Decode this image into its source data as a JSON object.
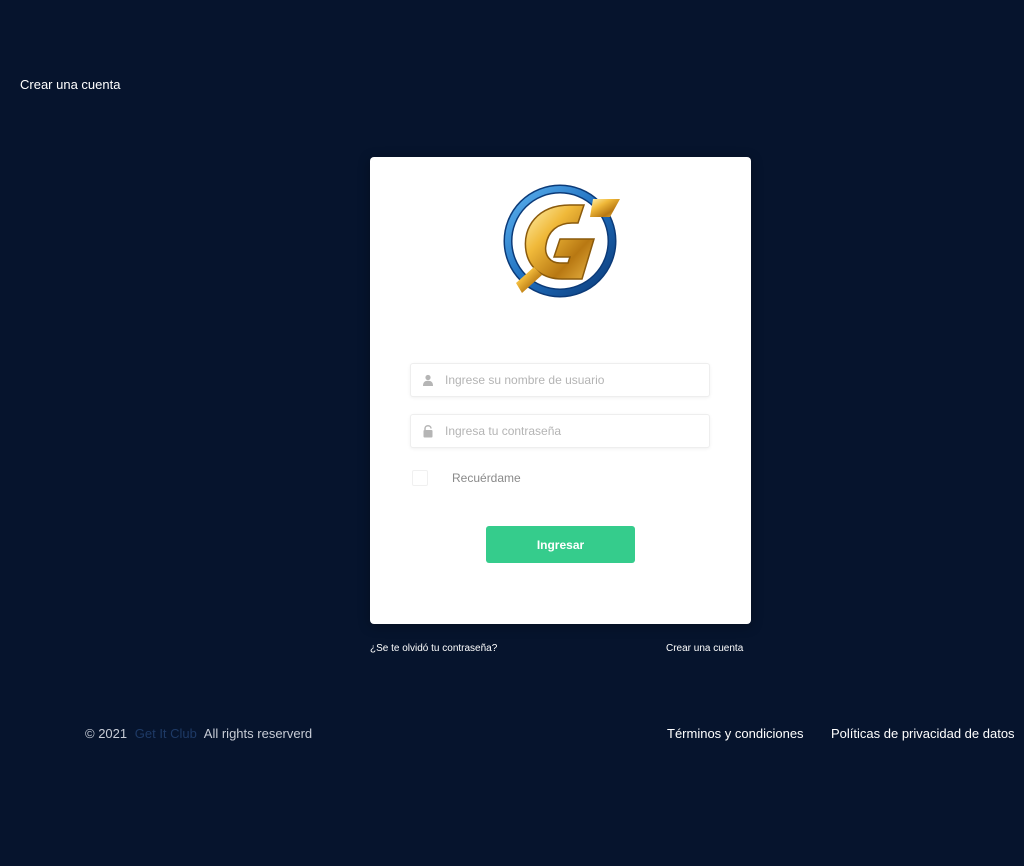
{
  "header": {
    "create_account": "Crear una cuenta"
  },
  "login": {
    "username_placeholder": "Ingrese su nombre de usuario",
    "password_placeholder": "Ingresa tu contraseña",
    "remember_label": "Recuérdame",
    "submit_label": "Ingresar",
    "username_icon": "user-icon",
    "password_icon": "lock-icon"
  },
  "links": {
    "forgot_password": "¿Se te olvidó tu contraseña?",
    "create_account": "Crear una cuenta"
  },
  "footer": {
    "copyright": "© 2021",
    "brand": "Get It Club",
    "rights": "All rights reserverd",
    "terms": "Términos y condiciones",
    "privacy": "Políticas de privacidad de datos"
  },
  "colors": {
    "background": "#06142d",
    "accent_button": "#35cc8c",
    "card": "#ffffff",
    "logo_gold": "#e0a72a",
    "logo_blue": "#1f6fbf"
  },
  "logo": {
    "letter": "G"
  }
}
